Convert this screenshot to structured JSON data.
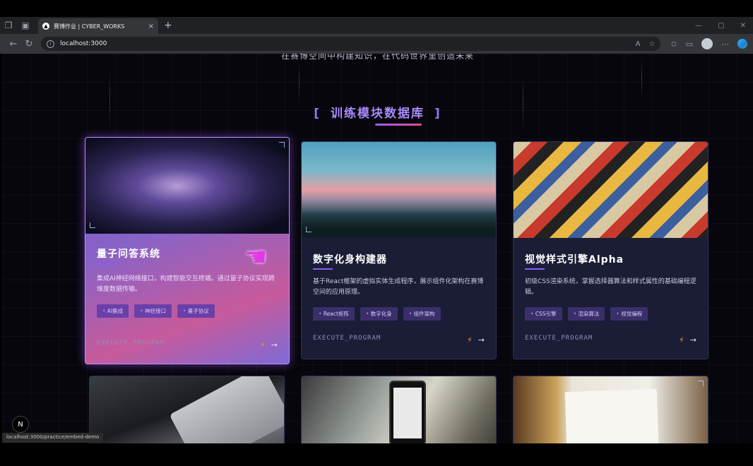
{
  "browser": {
    "tab_title": "赛博作业 | CYBER_WORKS",
    "tab_close": "×",
    "new_tab": "+",
    "url": "localhost:3000",
    "status_link": "localhost:3000/practice/embed-demo"
  },
  "page": {
    "subtitle": "在赛博空间中构建知识，在代码世界里创造未来",
    "section_title": "训练模块数据库",
    "bracket_left": "[",
    "bracket_right": "]",
    "next_badge": "N"
  },
  "cards": [
    {
      "title": "量子问答系统",
      "desc": "集成AI神经网络接口，构建智能交互终端。通过量子协议实现跨维度数据传输。",
      "tags": [
        "AI集成",
        "神经接口",
        "量子协议"
      ],
      "exec": "EXECUTE_PROGRAM",
      "bolt": "⚡",
      "arrow": "→"
    },
    {
      "title": "数字化身构建器",
      "desc": "基于React框架的虚拟实体生成程序，展示组件化架构在赛博空间的应用原理。",
      "tags": [
        "React矩阵",
        "数字化身",
        "组件架构"
      ],
      "exec": "EXECUTE_PROGRAM",
      "bolt": "⚡",
      "arrow": "→"
    },
    {
      "title": "视觉样式引擎Alpha",
      "desc": "初级CSS渲染系统，掌握选择器算法和样式属性的基础编程逻辑。",
      "tags": [
        "CSS引擎",
        "渲染算法",
        "视觉编程"
      ],
      "exec": "EXECUTE_PROGRAM",
      "bolt": "⚡",
      "arrow": "→"
    }
  ],
  "colors": {
    "accent": "#a78bfa",
    "bolt": "#f59e0b",
    "card_bg": "#1a1d35"
  }
}
